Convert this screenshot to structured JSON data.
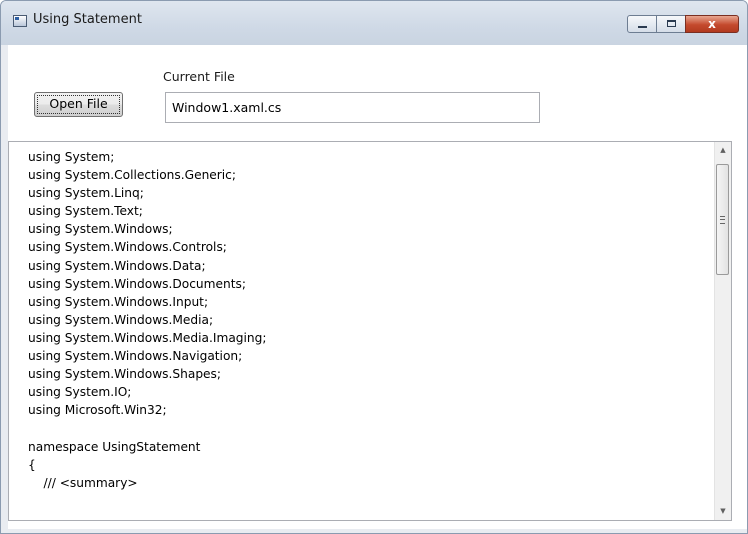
{
  "window": {
    "title": "Using Statement",
    "close_glyph": "x"
  },
  "form": {
    "current_file_label": "Current File",
    "open_button_label": "Open File",
    "current_file_value": "Window1.xaml.cs"
  },
  "icons": {
    "app": "window-icon",
    "minimize": "minimize-icon",
    "maximize": "maximize-icon",
    "close": "close-icon",
    "scroll_up": "scroll-up-arrow-icon",
    "scroll_down": "scroll-down-arrow-icon"
  },
  "scroll": {
    "up_glyph": "▲",
    "down_glyph": "▼"
  },
  "code": {
    "text": "using System;\nusing System.Collections.Generic;\nusing System.Linq;\nusing System.Text;\nusing System.Windows;\nusing System.Windows.Controls;\nusing System.Windows.Data;\nusing System.Windows.Documents;\nusing System.Windows.Input;\nusing System.Windows.Media;\nusing System.Windows.Media.Imaging;\nusing System.Windows.Navigation;\nusing System.Windows.Shapes;\nusing System.IO;\nusing Microsoft.Win32;\n\nnamespace UsingStatement\n{\n    /// <summary>"
  }
}
